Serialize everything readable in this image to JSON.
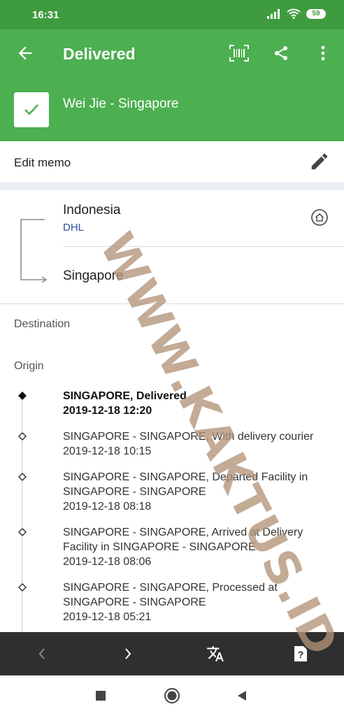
{
  "status": {
    "time": "16:31",
    "battery": "59"
  },
  "header": {
    "title": "Delivered",
    "subtitle": "Wei Jie - Singapore"
  },
  "memo": {
    "label": "Edit memo"
  },
  "route": {
    "from": "Indonesia",
    "carrier": "DHL",
    "to": "Singapore"
  },
  "sections": {
    "destination": "Destination",
    "origin": "Origin"
  },
  "events": [
    {
      "text": "SINGAPORE, Delivered",
      "date": "2019-12-18 12:20",
      "current": true
    },
    {
      "text": "SINGAPORE - SINGAPORE, With delivery courier",
      "date": "2019-12-18 10:15",
      "current": false
    },
    {
      "text": "SINGAPORE - SINGAPORE, Departed Facility in SINGAPORE - SINGAPORE",
      "date": "2019-12-18 08:18",
      "current": false
    },
    {
      "text": "SINGAPORE - SINGAPORE, Arrived at Delivery Facility in SINGAPORE - SINGAPORE",
      "date": "2019-12-18 08:06",
      "current": false
    },
    {
      "text": "SINGAPORE - SINGAPORE, Processed at SINGAPORE - SINGAPORE",
      "date": "2019-12-18 05:21",
      "current": false
    }
  ],
  "watermark": "WWW.KAKTUS.ID",
  "colors": {
    "primary": "#4caf50",
    "status_bar": "#3f9b3f",
    "nav_bar": "#2f2f2f",
    "carrier": "#2a4f9a"
  },
  "icons": {
    "back": "arrow-back-icon",
    "barcode": "barcode-scan-icon",
    "share": "share-icon",
    "more": "more-vert-icon",
    "check": "check-icon",
    "edit": "pencil-icon",
    "home": "home-circle-icon",
    "prev": "chevron-left-icon",
    "next": "chevron-right-icon",
    "translate": "translate-icon",
    "help": "help-icon",
    "recents": "square-icon",
    "home_sys": "circle-icon",
    "back_sys": "triangle-back-icon"
  }
}
